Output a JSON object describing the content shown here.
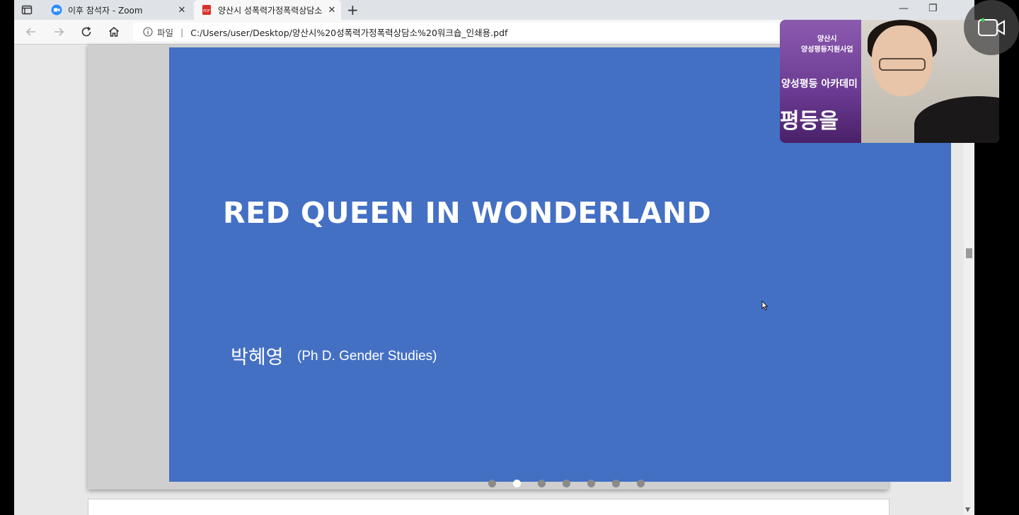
{
  "browser": {
    "tabs": [
      {
        "label": "이후 참석자 - Zoom",
        "active": false
      },
      {
        "label": "양산시 성폭력가정폭력상담소 워",
        "active": true
      }
    ],
    "url_prefix": "파일",
    "url_separator": "|",
    "url": "C:/Users/user/Desktop/양산시%20성폭력가정폭력상담소%20워크숍_인쇄용.pdf"
  },
  "slide": {
    "title": "RED QUEEN IN WONDERLAND",
    "author": "박혜영",
    "credentials": "(Ph D. Gender Studies)",
    "page_dots": 7,
    "current_dot": 2,
    "background_color": "#4470c4"
  },
  "video": {
    "banner_line1": "양산시\n양성평등지원사업",
    "banner_line2": "양성평등 아카데미",
    "banner_line3": "평등을"
  },
  "icons": [
    "tab-toggle-icon",
    "zoom-icon",
    "pdf-icon",
    "close-icon",
    "new-tab-icon",
    "minimize-icon",
    "maximize-icon",
    "back-icon",
    "forward-icon",
    "refresh-icon",
    "home-icon",
    "info-icon",
    "camera-icon",
    "cursor-icon"
  ]
}
